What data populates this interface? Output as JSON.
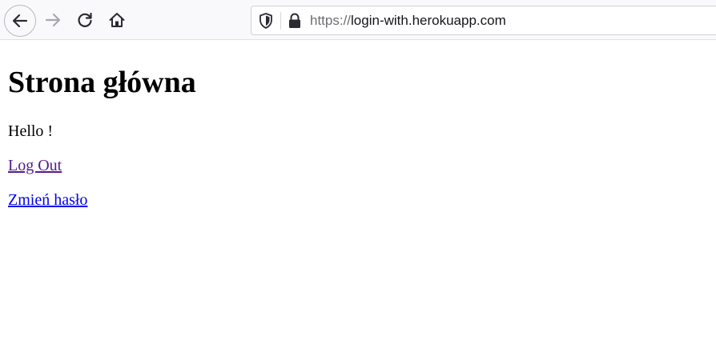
{
  "browser": {
    "icons": {
      "back": "arrow-left-icon",
      "forward": "arrow-right-icon",
      "reload": "reload-icon",
      "home": "home-icon",
      "tracking": "shield-icon",
      "lock": "lock-icon"
    },
    "url_scheme": "https://",
    "url_host": "login-with.herokuapp.com"
  },
  "page": {
    "heading": "Strona główna",
    "greeting": "Hello !",
    "logout_link": "Log Out",
    "change_password_link": "Zmień hasło"
  },
  "colors": {
    "visited_link": "#551a8b",
    "link": "#0000ee",
    "toolbar_bg": "#f9f9fb"
  }
}
